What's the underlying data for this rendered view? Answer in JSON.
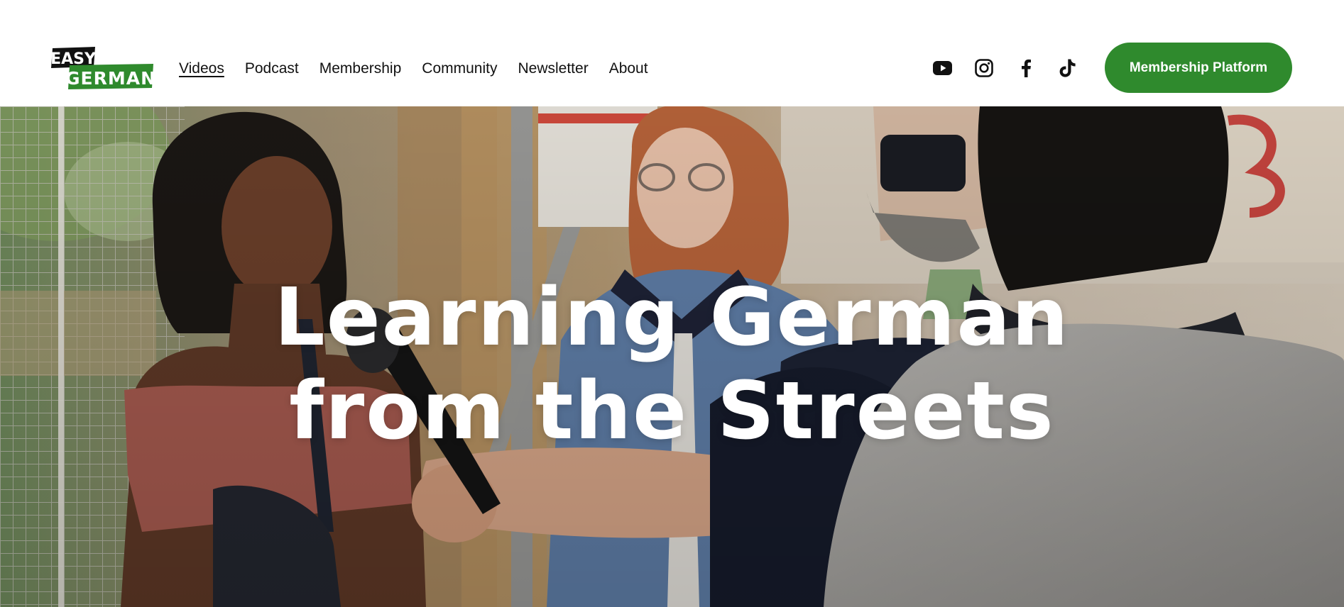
{
  "header": {
    "logo": {
      "line1": "EASY",
      "line2": "GERMAN",
      "brand_color": "#2f8a2d"
    },
    "nav": [
      {
        "label": "Videos",
        "active": true
      },
      {
        "label": "Podcast",
        "active": false
      },
      {
        "label": "Membership",
        "active": false
      },
      {
        "label": "Community",
        "active": false
      },
      {
        "label": "Newsletter",
        "active": false
      },
      {
        "label": "About",
        "active": false
      }
    ],
    "socials": [
      {
        "icon": "youtube-icon"
      },
      {
        "icon": "instagram-icon"
      },
      {
        "icon": "facebook-icon"
      },
      {
        "icon": "tiktok-icon"
      }
    ],
    "cta_label": "Membership Platform",
    "cta_color": "#2f8a2d"
  },
  "hero": {
    "title_line1": "Learning German",
    "title_line2": "from the Streets",
    "photo": "street-interview-photo"
  }
}
